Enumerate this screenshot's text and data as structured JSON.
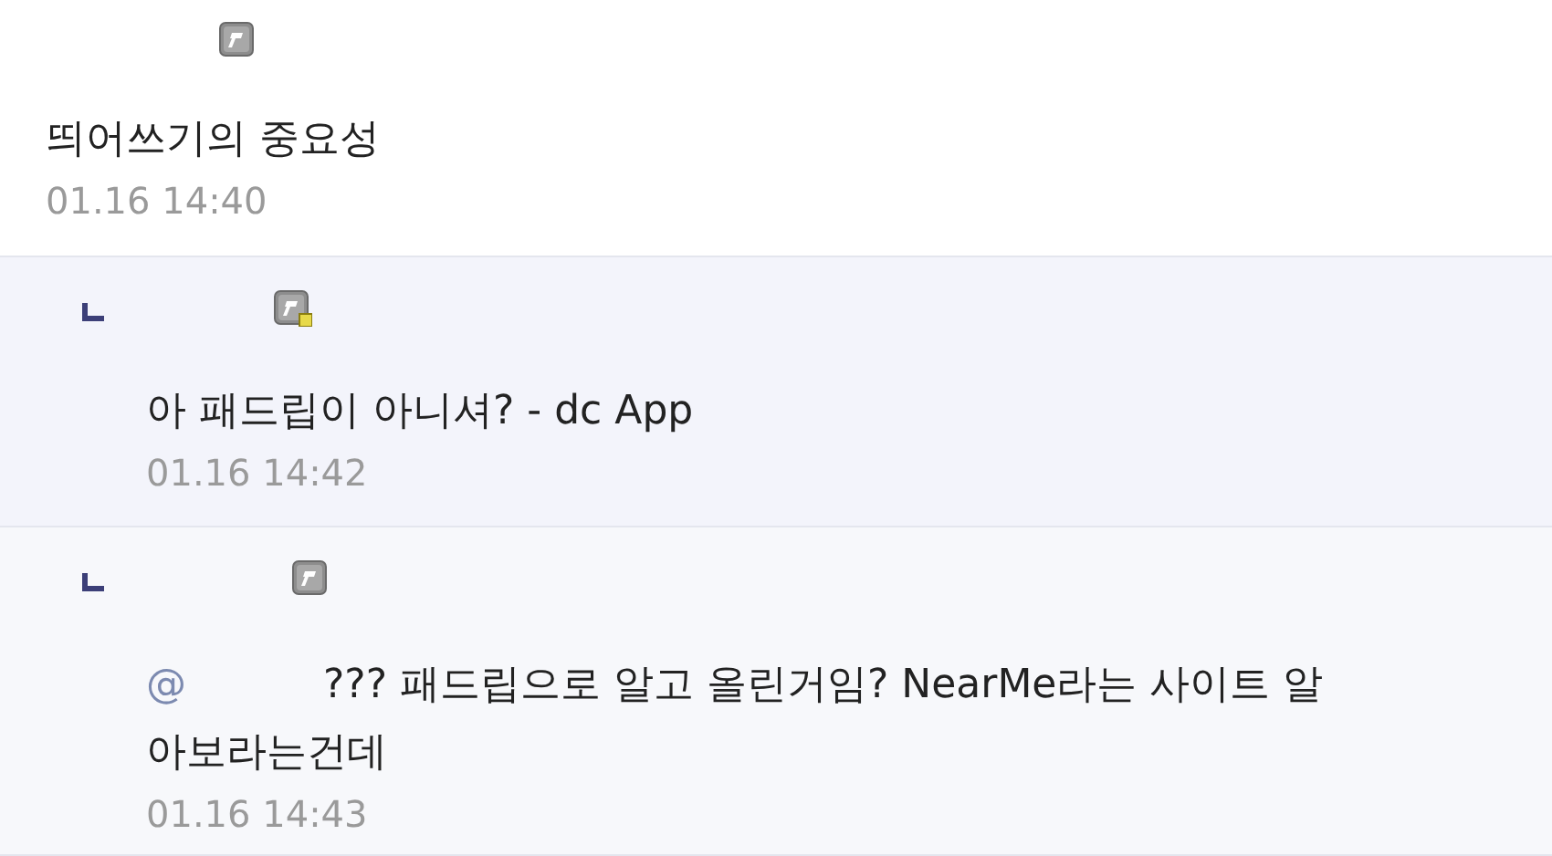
{
  "comments": [
    {
      "kind": "comment",
      "badge_dot": false,
      "text": "띄어쓰기의 중요성",
      "date": "01.16 14:40"
    },
    {
      "kind": "reply",
      "badge_dot": true,
      "text": "아 패드립이 아니셔? - dc App",
      "date": "01.16 14:42"
    },
    {
      "kind": "reply",
      "badge_dot": false,
      "mention": "@",
      "text": "??? 패드립으로 알고 올린거임? NearMe라는 사이트 알아보라는건데",
      "date": "01.16 14:43"
    }
  ]
}
